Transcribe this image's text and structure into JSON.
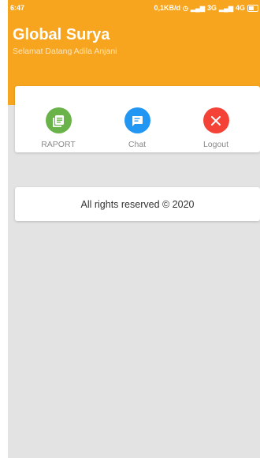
{
  "status_bar": {
    "time": "6:47",
    "network_speed": "0,1KB/d",
    "signal_1": "3G",
    "signal_2": "4G"
  },
  "header": {
    "title": "Global Surya",
    "subtitle": "Selamat Datang Adila Anjani",
    "background_color": "#f7a51f"
  },
  "menu": {
    "items": [
      {
        "label": "RAPORT",
        "icon": "report-icon",
        "color": "#6ab24a"
      },
      {
        "label": "Chat",
        "icon": "chat-icon",
        "color": "#2196f3"
      },
      {
        "label": "Logout",
        "icon": "close-icon",
        "color": "#f44336"
      }
    ]
  },
  "footer": {
    "text": "All rights reserved © 2020"
  }
}
